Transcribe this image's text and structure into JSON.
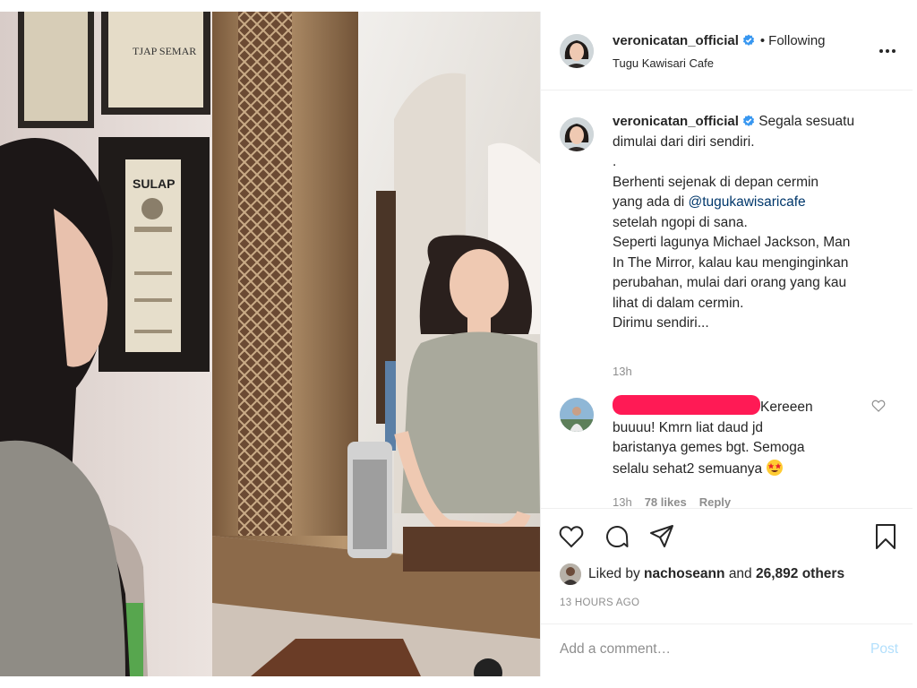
{
  "header": {
    "username": "veronicatan_official",
    "verified": true,
    "separator": "•",
    "follow_status": "Following",
    "location": "Tugu Kawisari Cafe",
    "more_icon": "more-options-icon"
  },
  "caption": {
    "username": "veronicatan_official",
    "lines": [
      "Segala sesuatu",
      "dimulai dari diri sendiri.",
      ".",
      "Berhenti sejenak di depan cermin",
      "yang ada di",
      "setelah ngopi di sana.",
      "Seperti lagunya Michael Jackson, Man",
      "In The Mirror, kalau kau menginginkan",
      "perubahan, mulai dari orang yang kau",
      "lihat di dalam cermin.",
      "Dirimu sendiri..."
    ],
    "mention": "@tugukawisaricafe",
    "time": "13h"
  },
  "comment": {
    "text_lines": [
      "Kereeen",
      "buuuu! Kmrn liat daud jd",
      "baristanya gemes bgt. Semoga",
      "selalu sehat2 semuanya"
    ],
    "emoji": "star-struck-emoji",
    "time": "13h",
    "likes": "78 likes",
    "reply": "Reply"
  },
  "actions": {
    "icons": [
      "heart-icon",
      "comment-icon",
      "share-icon",
      "bookmark-icon"
    ],
    "liked_by_prefix": "Liked by",
    "liked_by_user": "nachoseann",
    "liked_by_suffix": "and",
    "others_count": "26,892 others",
    "time_ago": "13 HOURS AGO"
  },
  "add_comment": {
    "placeholder": "Add a comment…",
    "post_label": "Post"
  },
  "colors": {
    "link": "#00376b",
    "verified": "#3897f0",
    "muted": "#8e8e8e",
    "post_disabled": "#b2dffc",
    "redaction": "#ff1a55"
  }
}
